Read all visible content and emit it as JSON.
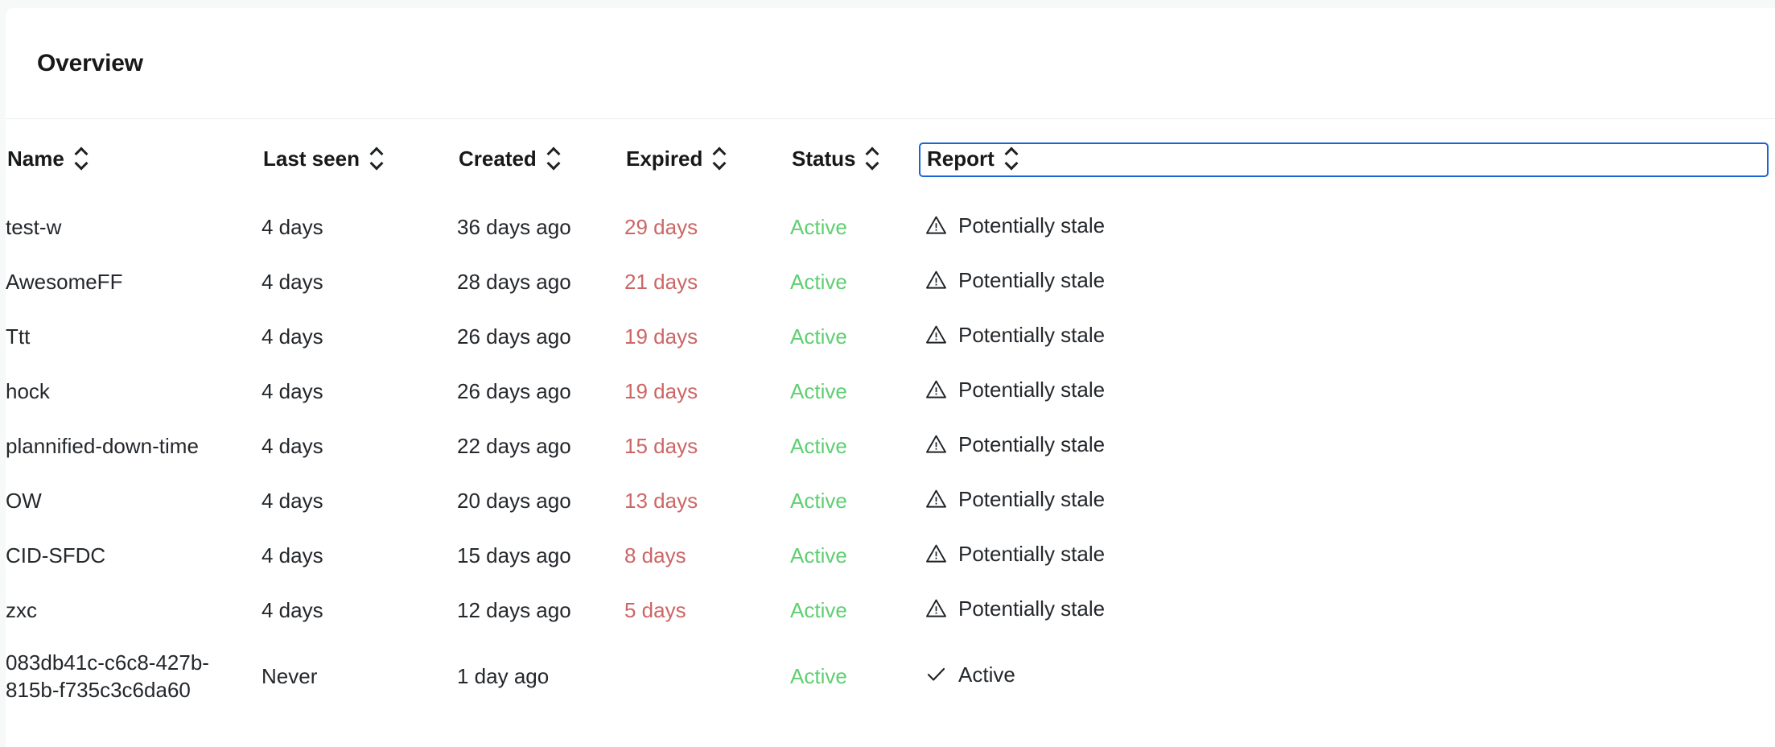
{
  "card": {
    "title": "Overview"
  },
  "table": {
    "columns": [
      {
        "key": "name",
        "label": "Name",
        "sortable": true,
        "focused": false
      },
      {
        "key": "last_seen",
        "label": "Last seen",
        "sortable": true,
        "focused": false
      },
      {
        "key": "created",
        "label": "Created",
        "sortable": true,
        "focused": false
      },
      {
        "key": "expired",
        "label": "Expired",
        "sortable": true,
        "focused": false
      },
      {
        "key": "status",
        "label": "Status",
        "sortable": true,
        "focused": false
      },
      {
        "key": "report",
        "label": "Report",
        "sortable": true,
        "focused": true
      }
    ],
    "rows": [
      {
        "name": "test-w",
        "last_seen": "4 days",
        "created": "36 days ago",
        "expired": "29 days",
        "status": "Active",
        "report": "Potentially stale",
        "report_icon": "warning-triangle-icon"
      },
      {
        "name": "AwesomeFF",
        "last_seen": "4 days",
        "created": "28 days ago",
        "expired": "21 days",
        "status": "Active",
        "report": "Potentially stale",
        "report_icon": "warning-triangle-icon"
      },
      {
        "name": "Ttt",
        "last_seen": "4 days",
        "created": "26 days ago",
        "expired": "19 days",
        "status": "Active",
        "report": "Potentially stale",
        "report_icon": "warning-triangle-icon"
      },
      {
        "name": "hock",
        "last_seen": "4 days",
        "created": "26 days ago",
        "expired": "19 days",
        "status": "Active",
        "report": "Potentially stale",
        "report_icon": "warning-triangle-icon"
      },
      {
        "name": "plannified-down-time",
        "last_seen": "4 days",
        "created": "22 days ago",
        "expired": "15 days",
        "status": "Active",
        "report": "Potentially stale",
        "report_icon": "warning-triangle-icon"
      },
      {
        "name": "OW",
        "last_seen": "4 days",
        "created": "20 days ago",
        "expired": "13 days",
        "status": "Active",
        "report": "Potentially stale",
        "report_icon": "warning-triangle-icon"
      },
      {
        "name": "CID-SFDC",
        "last_seen": "4 days",
        "created": "15 days ago",
        "expired": "8 days",
        "status": "Active",
        "report": "Potentially stale",
        "report_icon": "warning-triangle-icon"
      },
      {
        "name": "zxc",
        "last_seen": "4 days",
        "created": "12 days ago",
        "expired": "5 days",
        "status": "Active",
        "report": "Potentially stale",
        "report_icon": "warning-triangle-icon"
      },
      {
        "name": "083db41c-c6c8-427b-815b-f735c3c6da60",
        "last_seen": "Never",
        "created": "1 day ago",
        "expired": "",
        "status": "Active",
        "report": "Active",
        "report_icon": "check-icon"
      }
    ]
  },
  "colors": {
    "page_background": "#f7f8f8",
    "card_background": "#ffffff",
    "text": "#24272b",
    "heading": "#17181a",
    "divider": "#eceef0",
    "expired_red": "#cc6666",
    "status_green": "#5fcf72",
    "focus_ring_blue": "#1a64d4"
  },
  "icons": {
    "sort": "sort-chevrons-icon",
    "warning": "warning-triangle-icon",
    "check": "check-icon"
  }
}
